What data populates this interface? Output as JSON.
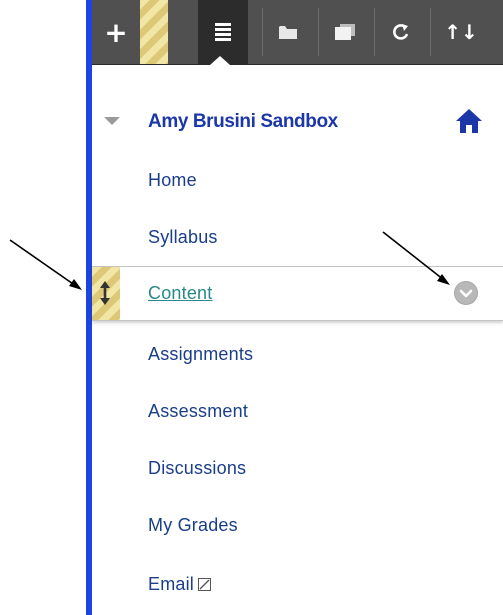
{
  "toolbar": {
    "buttons": [
      {
        "name": "add-menu-item",
        "glyph": "+"
      },
      {
        "name": "list-view",
        "glyph": "≣"
      },
      {
        "name": "folder-view",
        "glyph": "folder"
      },
      {
        "name": "new-window",
        "glyph": "window"
      },
      {
        "name": "refresh",
        "glyph": "↻"
      },
      {
        "name": "reorder",
        "glyph": "⇅"
      }
    ],
    "reorder_glyph": "↑↓"
  },
  "course": {
    "title": "Amy Brusini Sandbox"
  },
  "menu": {
    "items": [
      {
        "label": "Home"
      },
      {
        "label": "Syllabus"
      },
      {
        "label": "Content"
      },
      {
        "label": "Assignments"
      },
      {
        "label": "Assessment"
      },
      {
        "label": "Discussions"
      },
      {
        "label": "My Grades"
      },
      {
        "label": "Email"
      }
    ]
  },
  "colors": {
    "accent_border": "#1b45e0",
    "toolbar_bg": "#505050",
    "course_title": "#1b37a8",
    "menu_link": "#1a3e8a",
    "active_link": "#28888a"
  }
}
